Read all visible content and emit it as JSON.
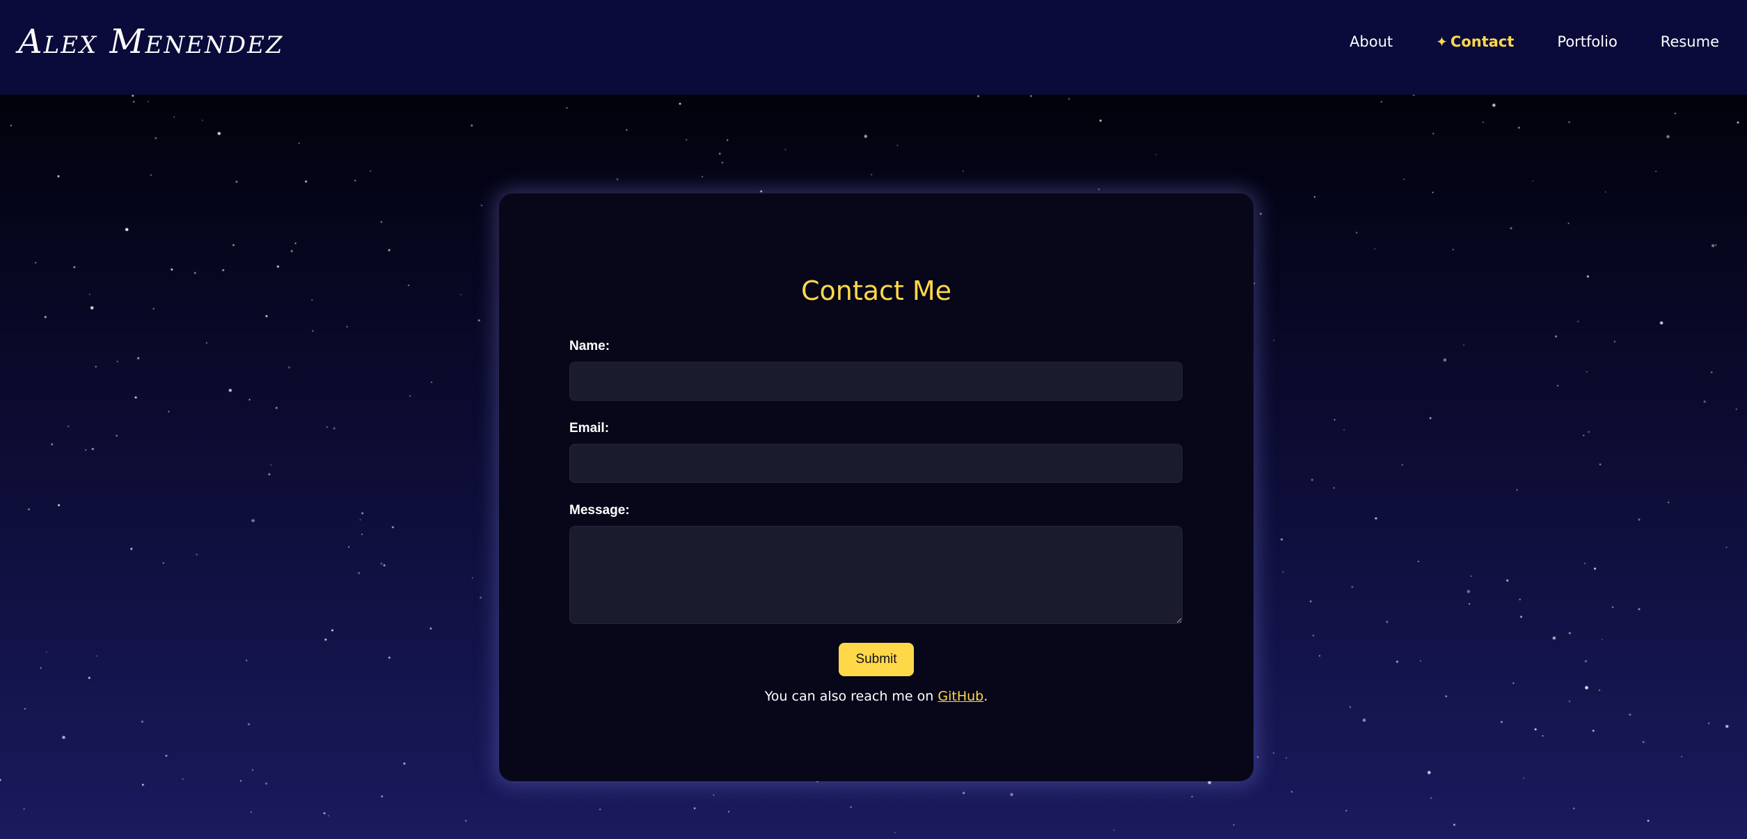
{
  "header": {
    "logo": "Alex Menendez",
    "nav": [
      {
        "label": "About",
        "active": false
      },
      {
        "label": "Contact",
        "active": true,
        "icon": "sparkle-icon"
      },
      {
        "label": "Portfolio",
        "active": false
      },
      {
        "label": "Resume",
        "active": false
      }
    ]
  },
  "form": {
    "title": "Contact Me",
    "name_label": "Name:",
    "name_value": "",
    "email_label": "Email:",
    "email_value": "",
    "message_label": "Message:",
    "message_value": "",
    "submit_label": "Submit",
    "note_prefix": "You can also reach me on ",
    "note_link": "GitHub",
    "note_suffix": "."
  },
  "colors": {
    "accent": "#ffd84a",
    "header_bg": "#0a0b3a",
    "card_bg": "#070719",
    "input_bg": "#1b1b2e"
  }
}
